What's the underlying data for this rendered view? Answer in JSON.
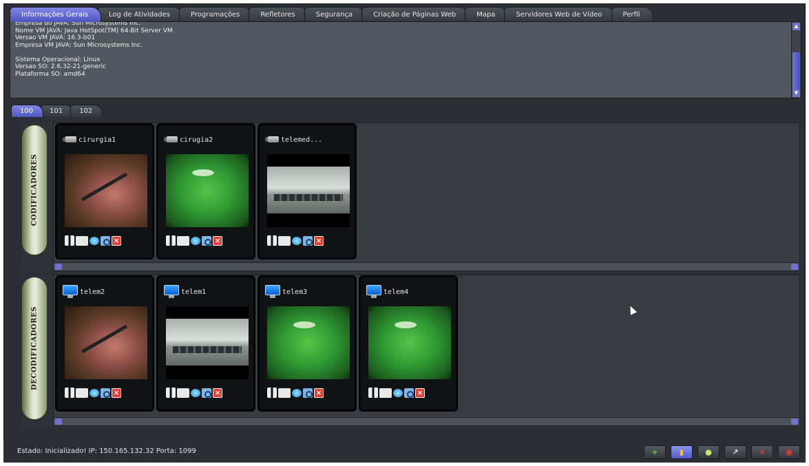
{
  "top_tabs": [
    {
      "label": "Informações Gerais",
      "active": true
    },
    {
      "label": "Log de Atividades",
      "active": false
    },
    {
      "label": "Programações",
      "active": false
    },
    {
      "label": "Refletores",
      "active": false
    },
    {
      "label": "Segurança",
      "active": false
    },
    {
      "label": "Criação de Páginas Web",
      "active": false
    },
    {
      "label": "Mapa",
      "active": false
    },
    {
      "label": "Servidores Web de Vídeo",
      "active": false
    },
    {
      "label": "Perfil",
      "active": false
    }
  ],
  "info_lines": "Empresa do JAVA: Sun Microsystems Inc.\nNome VM JAVA: Java HotSpot(TM) 64-Bit Server VM\nVersao VM JAVA: 16.3-b01\nEmpresa VM JAVA: Sun Microsystems Inc.\n\nSistema Operacional: Linux\nVersao SO: 2.6.32-21-generic\nPlataforma SO: amd64",
  "sub_tabs": [
    {
      "label": "100",
      "active": true
    },
    {
      "label": "101",
      "active": false
    },
    {
      "label": "102",
      "active": false
    }
  ],
  "encoders": {
    "label": "CODIFICADORES",
    "devices": [
      {
        "name": "cirurgia1",
        "preview": "surgery-red"
      },
      {
        "name": "cirugia2",
        "preview": "green-or"
      },
      {
        "name": "telemed...",
        "preview": "waiting-room"
      }
    ]
  },
  "decoders": {
    "label": "DECODIFICADORES",
    "devices": [
      {
        "name": "telem2",
        "preview": "surgery-red"
      },
      {
        "name": "telem1",
        "preview": "waiting-room"
      },
      {
        "name": "telem3",
        "preview": "green-or"
      },
      {
        "name": "telem4",
        "preview": "green-or"
      }
    ]
  },
  "status": {
    "text": "Estado: Inicializado! IP: 150.165.132.32 Porta: 1099"
  },
  "status_buttons": [
    {
      "icon": "add-icon",
      "glyph": "+",
      "color": "#5fd14a"
    },
    {
      "icon": "folder-icon",
      "glyph": "▮",
      "color": "#f2c12e",
      "active": true
    },
    {
      "icon": "record-icon",
      "glyph": "●",
      "color": "#c7e86a"
    },
    {
      "icon": "arrow-icon",
      "glyph": "↗",
      "color": "#e6e6e6"
    },
    {
      "icon": "close-icon",
      "glyph": "×",
      "color": "#e83a2e"
    },
    {
      "icon": "trash-icon",
      "glyph": "▣",
      "color": "#e83a2e"
    }
  ],
  "colors": {
    "accent": "#5a62d6",
    "background": "#2b2e34"
  }
}
